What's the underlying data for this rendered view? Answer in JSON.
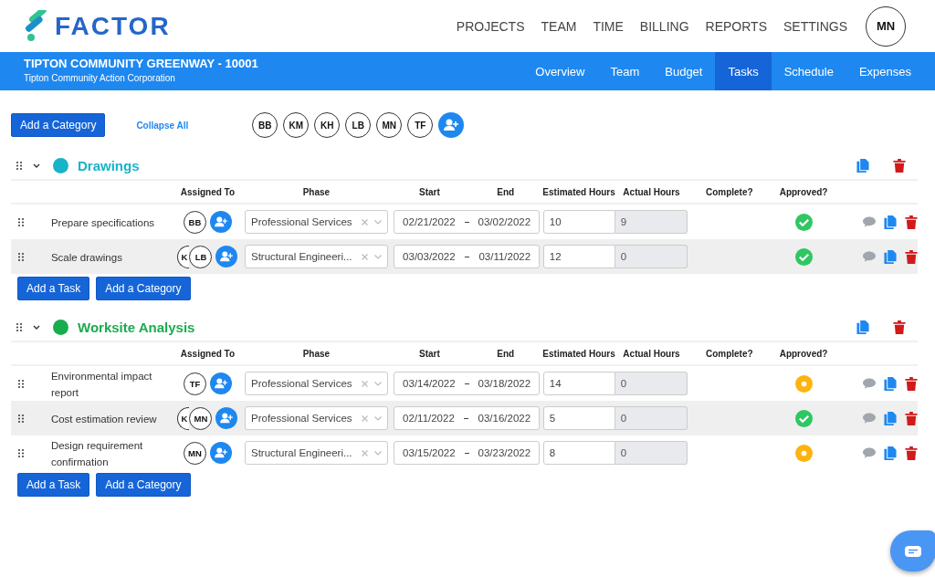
{
  "brand": "FACTOR",
  "nav": [
    "PROJECTS",
    "TEAM",
    "TIME",
    "BILLING",
    "REPORTS",
    "SETTINGS"
  ],
  "user": "MN",
  "project": {
    "title": "TIPTON COMMUNITY GREENWAY - 10001",
    "client": "Tipton Community Action Corporation"
  },
  "tabs": [
    {
      "label": "Overview",
      "selected": false
    },
    {
      "label": "Team",
      "selected": false
    },
    {
      "label": "Budget",
      "selected": false
    },
    {
      "label": "Tasks",
      "selected": true
    },
    {
      "label": "Schedule",
      "selected": false
    },
    {
      "label": "Expenses",
      "selected": false
    }
  ],
  "toolbar": {
    "add_category": "Add a Category",
    "collapse_all": "Collapse All",
    "team": [
      "BB",
      "KM",
      "KH",
      "LB",
      "MN",
      "TF"
    ]
  },
  "categories": [
    {
      "name": "Drawings",
      "color": "#17b3c9",
      "expanded": true,
      "add_task": "Add a Task",
      "add_category": "Add a Category",
      "columns": [
        "Assigned To",
        "Phase",
        "Start",
        "End",
        "Estimated Hours",
        "Actual Hours",
        "Complete?",
        "Approved?"
      ],
      "tasks": [
        {
          "name": "Prepare specifications",
          "assignees": [
            "BB"
          ],
          "phase": "Professional Services",
          "start": "02/21/2022",
          "end": "03/02/2022",
          "estimated": "10",
          "actual": "9",
          "approved": true,
          "highlighted": false
        },
        {
          "name": "Scale drawings",
          "assignees": [
            "K",
            "LB"
          ],
          "phase": "Structural Engineeri...",
          "start": "03/03/2022",
          "end": "03/11/2022",
          "estimated": "12",
          "actual": "0",
          "approved": true,
          "highlighted": true
        }
      ]
    },
    {
      "name": "Worksite Analysis",
      "color": "#19ac4e",
      "expanded": true,
      "add_task": "Add a Task",
      "add_category": "Add a Category",
      "columns": [
        "Assigned To",
        "Phase",
        "Start",
        "End",
        "Estimated Hours",
        "Actual Hours",
        "Complete?",
        "Approved?"
      ],
      "tasks": [
        {
          "name": "Environmental impact report",
          "assignees": [
            "TF"
          ],
          "phase": "Professional Services",
          "start": "03/14/2022",
          "end": "03/18/2022",
          "estimated": "14",
          "actual": "0",
          "approved": false,
          "highlighted": false
        },
        {
          "name": "Cost estimation review",
          "assignees": [
            "K",
            "MN"
          ],
          "phase": "Professional Services",
          "start": "02/11/2022",
          "end": "03/16/2022",
          "estimated": "5",
          "actual": "0",
          "approved": true,
          "highlighted": true
        },
        {
          "name": "Design requirement confirmation",
          "assignees": [
            "MN"
          ],
          "phase": "Structural Engineeri...",
          "start": "03/15/2022",
          "end": "03/23/2022",
          "estimated": "8",
          "actual": "0",
          "approved": false,
          "highlighted": false
        }
      ]
    }
  ]
}
